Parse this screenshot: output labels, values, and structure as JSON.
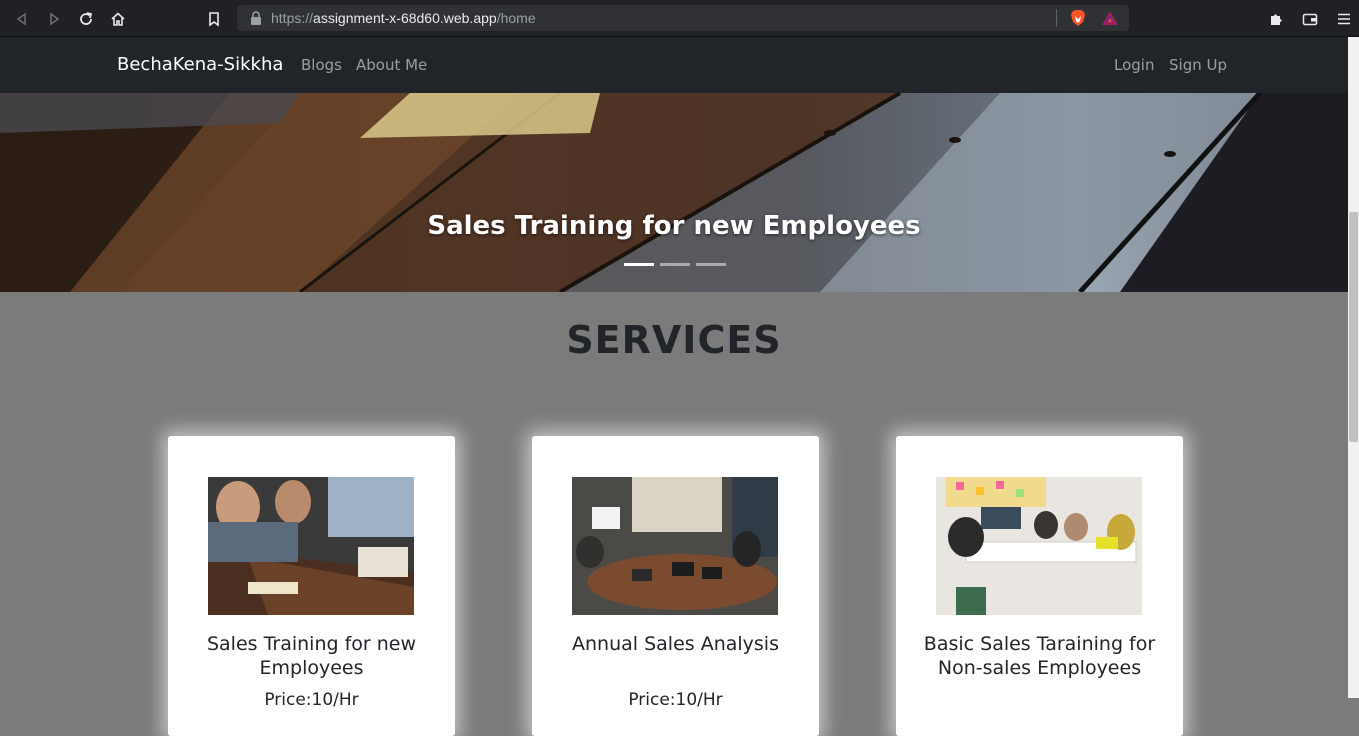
{
  "browser": {
    "url_scheme": "https://",
    "url_host": "assignment-x-68d60.web.app",
    "url_path": "/home"
  },
  "navbar": {
    "brand": "BechaKena-Sikkha",
    "links": [
      "Blogs",
      "About Me"
    ],
    "login": "Login",
    "signup": "Sign Up"
  },
  "hero": {
    "caption": "Sales Training for new Employees",
    "slides": 3,
    "active_slide": 1
  },
  "services": {
    "title": "SERVICES",
    "cards": [
      {
        "title": "Sales Training for new Employees",
        "price": "Price:10/Hr"
      },
      {
        "title": "Annual Sales Analysis",
        "price": "Price:10/Hr"
      },
      {
        "title": "Basic Sales Taraining for Non-sales Employees",
        "price": ""
      }
    ]
  }
}
